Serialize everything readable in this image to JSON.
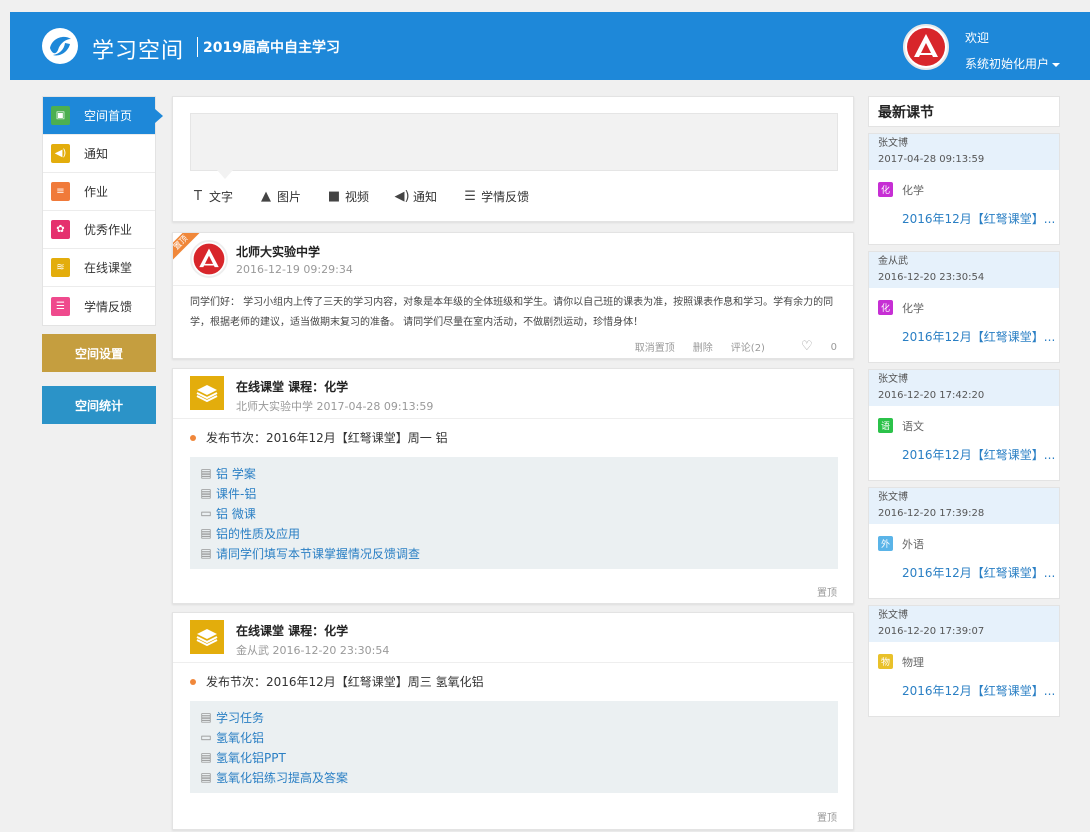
{
  "header": {
    "brand": "学习空间",
    "subtitle": "2019届高中自主学习",
    "welcome": "欢迎",
    "username": "系统初始化用户"
  },
  "sidebar": {
    "items": [
      {
        "label": "空间首页",
        "icon": "home-icon",
        "color": "#4caf50"
      },
      {
        "label": "通知",
        "icon": "speaker-icon",
        "color": "#e3ad0c"
      },
      {
        "label": "作业",
        "icon": "document-icon",
        "color": "#f07a3a"
      },
      {
        "label": "优秀作业",
        "icon": "award-icon",
        "color": "#e5306e"
      },
      {
        "label": "在线课堂",
        "icon": "stack-icon",
        "color": "#e3ad0c"
      },
      {
        "label": "学情反馈",
        "icon": "report-icon",
        "color": "#ef4a8d"
      }
    ],
    "settings_label": "空间设置",
    "stats_label": "空间统计"
  },
  "composer": {
    "tools": [
      {
        "label": "文字",
        "glyph": "T"
      },
      {
        "label": "图片",
        "glyph": "▲"
      },
      {
        "label": "视频",
        "glyph": "■"
      },
      {
        "label": "通知",
        "glyph": "◀)"
      },
      {
        "label": "学情反馈",
        "glyph": "☰"
      }
    ]
  },
  "post": {
    "badge": "置顶",
    "author": "北师大实验中学",
    "time": "2016-12-19 09:29:34",
    "text": "同学们好： 学习小组内上传了三天的学习内容，对象是本年级的全体班级和学生。请你以自己班的课表为准，按照课表作息和学习。学有余力的同学，根据老师的建议，适当做期末复习的准备。 请同学们尽量在室内活动，不做剧烈运动，珍惜身体！",
    "actions": {
      "unpin": "取消置顶",
      "delete": "删除",
      "comment": "评论(2)",
      "likes": "0"
    }
  },
  "courses": [
    {
      "title": "在线课堂 课程：化学",
      "meta": "北师大实验中学 2017-04-28 09:13:59",
      "release": "发布节次：2016年12月【红弩课堂】周一 铝",
      "resources": [
        {
          "label": "铝 学案",
          "icon": "doc-icon"
        },
        {
          "label": "课件-铝",
          "icon": "doc-icon"
        },
        {
          "label": "铝 微课",
          "icon": "video-icon"
        },
        {
          "label": "铝的性质及应用",
          "icon": "doc-icon"
        },
        {
          "label": "请同学们填写本节课掌握情况反馈调查",
          "icon": "doc-icon"
        }
      ],
      "pin": "置顶"
    },
    {
      "title": "在线课堂 课程：化学",
      "meta": "金从武 2016-12-20 23:30:54",
      "release": "发布节次：2016年12月【红弩课堂】周三 氢氧化铝",
      "resources": [
        {
          "label": "学习任务",
          "icon": "doc-icon"
        },
        {
          "label": "氢氧化铝",
          "icon": "video-icon"
        },
        {
          "label": "氢氧化铝PPT",
          "icon": "doc-icon"
        },
        {
          "label": "氢氧化铝练习提高及答案",
          "icon": "doc-icon"
        }
      ],
      "pin": "置顶"
    }
  ],
  "latest": {
    "title": "最新课节",
    "lessons": [
      {
        "teacher": "张文博",
        "time": "2017-04-28 09:13:59",
        "subject": "化学",
        "badge": "化",
        "color": "#c62fd4",
        "link": "2016年12月【红弩课堂】..."
      },
      {
        "teacher": "金从武",
        "time": "2016-12-20 23:30:54",
        "subject": "化学",
        "badge": "化",
        "color": "#c62fd4",
        "link": "2016年12月【红弩课堂】..."
      },
      {
        "teacher": "张文博",
        "time": "2016-12-20 17:42:20",
        "subject": "语文",
        "badge": "语",
        "color": "#2bc24a",
        "link": "2016年12月【红弩课堂】..."
      },
      {
        "teacher": "张文博",
        "time": "2016-12-20 17:39:28",
        "subject": "外语",
        "badge": "外",
        "color": "#5ab4e8",
        "link": "2016年12月【红弩课堂】..."
      },
      {
        "teacher": "张文博",
        "time": "2016-12-20 17:39:07",
        "subject": "物理",
        "badge": "物",
        "color": "#e9c12a",
        "link": "2016年12月【红弩课堂】..."
      }
    ]
  }
}
